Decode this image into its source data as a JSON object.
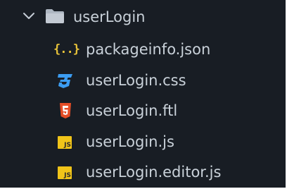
{
  "explorer": {
    "folder": {
      "name": "userLogin",
      "expanded": true,
      "icon": "folder-icon"
    },
    "files": [
      {
        "name": "packageinfo.json",
        "icon": "json-braces-icon",
        "icon_text": "{..}",
        "icon_color": "#e8c33a"
      },
      {
        "name": "userLogin.css",
        "icon": "css-icon",
        "icon_color": "#3c9df2"
      },
      {
        "name": "userLogin.ftl",
        "icon": "html5-icon",
        "icon_color": "#e44d26"
      },
      {
        "name": "userLogin.js",
        "icon": "js-icon",
        "icon_text": "JS",
        "icon_color": "#f0c419"
      },
      {
        "name": "userLogin.editor.js",
        "icon": "js-icon",
        "icon_text": "JS",
        "icon_color": "#f0c419"
      }
    ]
  }
}
